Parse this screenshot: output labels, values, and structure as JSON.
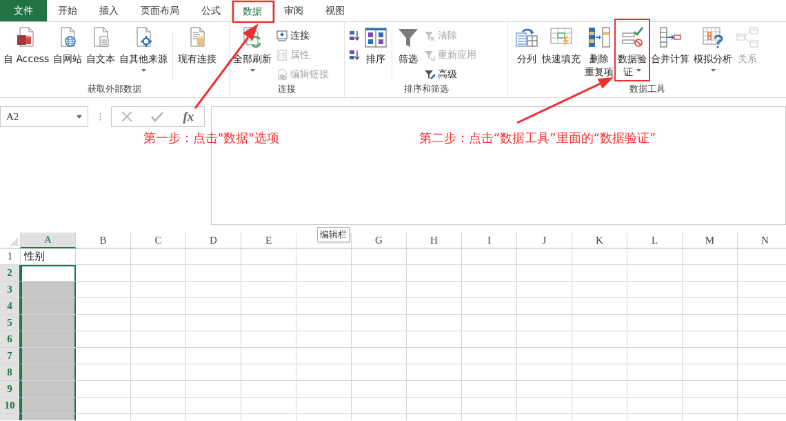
{
  "menu_tabs": [
    {
      "label": "文件",
      "kind": "file",
      "selected": false
    },
    {
      "label": "开始",
      "kind": "tab",
      "selected": false
    },
    {
      "label": "插入",
      "kind": "tab",
      "selected": false
    },
    {
      "label": "页面布局",
      "kind": "tab",
      "selected": false
    },
    {
      "label": "公式",
      "kind": "tab",
      "selected": false
    },
    {
      "label": "数据",
      "kind": "tab",
      "selected": true
    },
    {
      "label": "审阅",
      "kind": "tab",
      "selected": false
    },
    {
      "label": "视图",
      "kind": "tab",
      "selected": false
    }
  ],
  "ribbon_groups": [
    {
      "label": "获取外部数据",
      "items": [
        {
          "kind": "large",
          "lines": [
            "自 Access"
          ],
          "dropdown": false,
          "disabled": false
        },
        {
          "kind": "large",
          "lines": [
            "自网站"
          ],
          "dropdown": false,
          "disabled": false
        },
        {
          "kind": "large",
          "lines": [
            "自文本"
          ],
          "dropdown": false,
          "disabled": false
        },
        {
          "kind": "large",
          "lines": [
            "自其他来源"
          ],
          "dropdown": true,
          "disabled": false
        },
        {
          "kind": "separator"
        },
        {
          "kind": "large",
          "lines": [
            "现有连接"
          ],
          "dropdown": false,
          "disabled": false
        }
      ]
    },
    {
      "label": "连接",
      "items": [
        {
          "kind": "large",
          "lines": [
            "全部刷新"
          ],
          "dropdown": true,
          "disabled": false
        },
        {
          "kind": "stack",
          "buttons": [
            {
              "label": "连接",
              "disabled": false
            },
            {
              "label": "属性",
              "disabled": true
            },
            {
              "label": "编辑链接",
              "disabled": true
            }
          ]
        }
      ]
    },
    {
      "label": "排序和筛选",
      "items": [
        {
          "kind": "stack",
          "buttons": [
            {
              "disabled": false
            },
            {
              "disabled": false
            }
          ]
        },
        {
          "kind": "large",
          "lines": [
            "排序"
          ],
          "dropdown": false,
          "disabled": false
        },
        {
          "kind": "separator"
        },
        {
          "kind": "large",
          "lines": [
            "筛选"
          ],
          "dropdown": false,
          "disabled": false
        },
        {
          "kind": "stack",
          "buttons": [
            {
              "label": "清除",
              "disabled": true
            },
            {
              "label": "重新应用",
              "disabled": true
            },
            {
              "label": "高级",
              "disabled": false
            }
          ]
        }
      ]
    },
    {
      "label": "数据工具",
      "items": [
        {
          "kind": "large",
          "lines": [
            "分列"
          ],
          "dropdown": false,
          "disabled": false
        },
        {
          "kind": "large",
          "lines": [
            "快速填充"
          ],
          "dropdown": false,
          "disabled": false
        },
        {
          "kind": "large",
          "lines": [
            "删除",
            "重复项"
          ],
          "dropdown": false,
          "disabled": false
        },
        {
          "kind": "large",
          "lines": [
            "数据验",
            "证"
          ],
          "dropdown": true,
          "disabled": false
        },
        {
          "kind": "large",
          "lines": [
            "合并计算"
          ],
          "dropdown": false,
          "disabled": false
        },
        {
          "kind": "large",
          "lines": [
            "模拟分析"
          ],
          "dropdown": true,
          "disabled": false
        },
        {
          "kind": "large",
          "lines": [
            "关系"
          ],
          "dropdown": false,
          "disabled": true
        }
      ]
    }
  ],
  "formula_bar": {
    "name_box": "A2",
    "function_button": "fx",
    "tooltip": "编辑栏"
  },
  "annotations": [
    {
      "text": "第一步：点击\"数据\"选项"
    },
    {
      "text": "第二步：点击“数据工具”里面的“数据验证”"
    }
  ],
  "sheet": {
    "columns": [
      {
        "label": "A",
        "selected": true
      },
      {
        "label": "B",
        "selected": false
      },
      {
        "label": "C",
        "selected": false
      },
      {
        "label": "D",
        "selected": false
      },
      {
        "label": "E",
        "selected": false
      },
      {
        "selected": false
      },
      {
        "label": "G",
        "selected": false
      },
      {
        "label": "H",
        "selected": false
      },
      {
        "label": "I",
        "selected": false
      },
      {
        "label": "J",
        "selected": false
      },
      {
        "label": "K",
        "selected": false
      },
      {
        "label": "L",
        "selected": false
      },
      {
        "label": "M",
        "selected": false
      },
      {
        "label": "N",
        "selected": false
      }
    ],
    "rows": [
      {
        "label": "1",
        "selected": false,
        "cells": [
          {
            "text": "性别",
            "selected": false,
            "active": false
          }
        ]
      },
      {
        "label": "2",
        "selected": true,
        "cells": [
          {
            "selected": true,
            "active": true
          }
        ]
      },
      {
        "label": "3",
        "selected": true,
        "cells": [
          {
            "selected": true,
            "active": false
          }
        ]
      },
      {
        "label": "4",
        "selected": true,
        "cells": [
          {
            "selected": true,
            "active": false
          }
        ]
      },
      {
        "label": "5",
        "selected": true,
        "cells": [
          {
            "selected": true,
            "active": false
          }
        ]
      },
      {
        "label": "6",
        "selected": true,
        "cells": [
          {
            "selected": true,
            "active": false
          }
        ]
      },
      {
        "label": "7",
        "selected": true,
        "cells": [
          {
            "selected": true,
            "active": false
          }
        ]
      },
      {
        "label": "8",
        "selected": true,
        "cells": [
          {
            "selected": true,
            "active": false
          }
        ]
      },
      {
        "label": "9",
        "selected": true,
        "cells": [
          {
            "selected": true,
            "active": false
          }
        ]
      },
      {
        "label": "10",
        "selected": true,
        "cells": [
          {
            "selected": true,
            "active": false
          }
        ]
      }
    ]
  }
}
